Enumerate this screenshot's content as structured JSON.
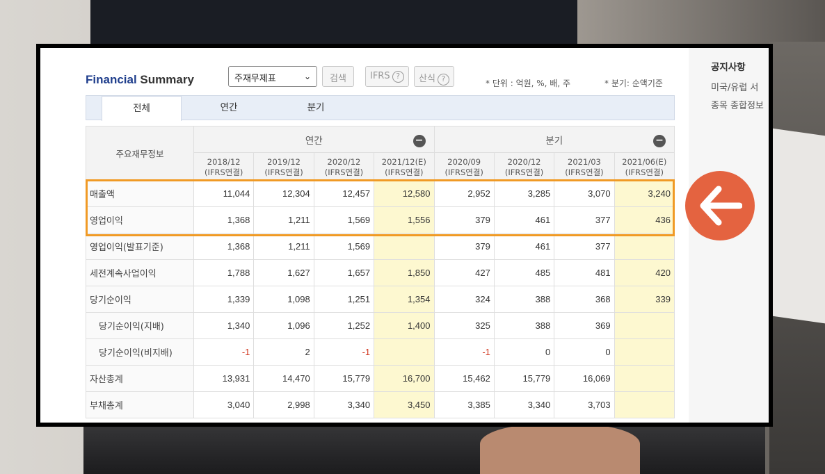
{
  "header": {
    "title_part1": "Financial",
    "title_part2": "Summary",
    "select_value": "주재무제표",
    "search_label": "검색",
    "ifrs_label": "IFRS",
    "calc_label": "산식",
    "unit_note": "* 단위 : 억원, %, 배, 주",
    "quarter_note": "* 분기: 순액기준"
  },
  "tabs": [
    "전체",
    "연간",
    "분기"
  ],
  "table": {
    "row_header_title": "주요재무정보",
    "annual_group": "연간",
    "quarter_group": "분기",
    "periods": [
      {
        "date": "2018/12",
        "basis": "(IFRS연결)"
      },
      {
        "date": "2019/12",
        "basis": "(IFRS연결)"
      },
      {
        "date": "2020/12",
        "basis": "(IFRS연결)"
      },
      {
        "date": "2021/12(E)",
        "basis": "(IFRS연결)"
      },
      {
        "date": "2020/09",
        "basis": "(IFRS연결)"
      },
      {
        "date": "2020/12",
        "basis": "(IFRS연결)"
      },
      {
        "date": "2021/03",
        "basis": "(IFRS연결)"
      },
      {
        "date": "2021/06(E)",
        "basis": "(IFRS연결)"
      }
    ],
    "rows": [
      {
        "label": "매출액",
        "values": [
          "11,044",
          "12,304",
          "12,457",
          "12,580",
          "2,952",
          "3,285",
          "3,070",
          "3,240"
        ]
      },
      {
        "label": "영업이익",
        "values": [
          "1,368",
          "1,211",
          "1,569",
          "1,556",
          "379",
          "461",
          "377",
          "436"
        ]
      },
      {
        "label": "영업이익(발표기준)",
        "values": [
          "1,368",
          "1,211",
          "1,569",
          "",
          "379",
          "461",
          "377",
          ""
        ]
      },
      {
        "label": "세전계속사업이익",
        "values": [
          "1,788",
          "1,627",
          "1,657",
          "1,850",
          "427",
          "485",
          "481",
          "420"
        ]
      },
      {
        "label": "당기순이익",
        "values": [
          "1,339",
          "1,098",
          "1,251",
          "1,354",
          "324",
          "388",
          "368",
          "339"
        ]
      },
      {
        "label": "당기순이익(지배)",
        "values": [
          "1,340",
          "1,096",
          "1,252",
          "1,400",
          "325",
          "388",
          "369",
          ""
        ]
      },
      {
        "label": "당기순이익(비지배)",
        "values": [
          "-1",
          "2",
          "-1",
          "",
          "-1",
          "0",
          "0",
          ""
        ]
      },
      {
        "label": "자산총계",
        "values": [
          "13,931",
          "14,470",
          "15,779",
          "16,700",
          "15,462",
          "15,779",
          "16,069",
          ""
        ]
      },
      {
        "label": "부채총계",
        "values": [
          "3,040",
          "2,998",
          "3,340",
          "3,450",
          "3,385",
          "3,340",
          "3,703",
          ""
        ]
      }
    ]
  },
  "sidebar": {
    "heading": "공지사항",
    "line1": "미국/유럽 서",
    "line2": "종목 종합정보"
  },
  "colors": {
    "highlight_border": "#f09a25",
    "arrow_circle": "#e46340",
    "estimate_fill": "#fdf8d0",
    "negative_text": "#d0341c"
  }
}
